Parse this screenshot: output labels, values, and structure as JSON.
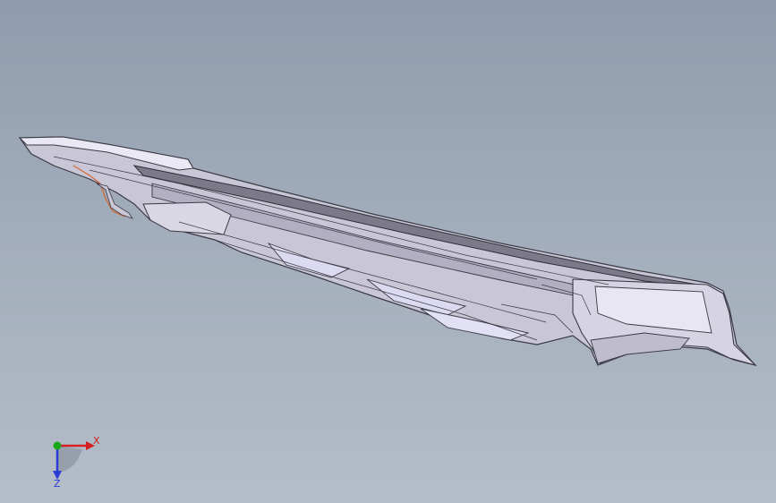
{
  "viewport": {
    "background_top": "#8e9cad",
    "background_bottom": "#b4bdc8"
  },
  "model": {
    "icon": "automotive-rear-diffuser-part",
    "shade_color": "#c9c6d6",
    "edge_color": "#3a3a44",
    "highlight_color": "#e9e8f3",
    "accent_color": "#d26a3a"
  },
  "triad": {
    "x_label": "X",
    "z_label": "Z",
    "x_color": "#d42020",
    "y_color": "#1aa81a",
    "z_color": "#2a3bd6"
  }
}
